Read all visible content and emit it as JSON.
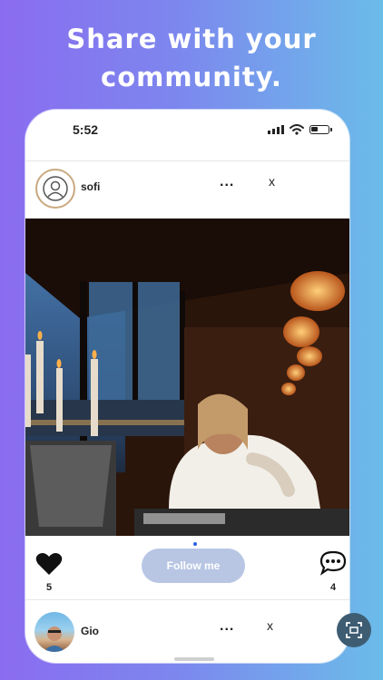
{
  "headline": {
    "line1": "Share with your",
    "line2": "community."
  },
  "status_bar": {
    "time": "5:52"
  },
  "post1": {
    "username": "sofi",
    "more_label": "...",
    "close_label": "x",
    "likes": "5",
    "comments": "4",
    "follow_label": "Follow me"
  },
  "post2": {
    "username": "Gio",
    "more_label": "...",
    "close_label": "x"
  },
  "colors": {
    "follow_button": "#b8c6e4",
    "scan_button": "#3e5d73",
    "indicator": "#2b5fe0"
  },
  "icons": [
    "person-icon",
    "heart-icon",
    "comment-icon",
    "scan-icon",
    "wifi-icon",
    "battery-icon",
    "signal-icon"
  ]
}
